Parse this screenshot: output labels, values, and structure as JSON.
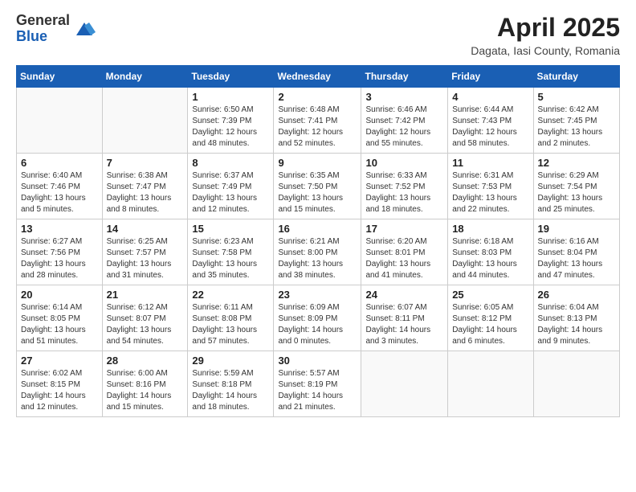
{
  "logo": {
    "general": "General",
    "blue": "Blue"
  },
  "title": "April 2025",
  "subtitle": "Dagata, Iasi County, Romania",
  "days_header": [
    "Sunday",
    "Monday",
    "Tuesday",
    "Wednesday",
    "Thursday",
    "Friday",
    "Saturday"
  ],
  "weeks": [
    [
      {
        "day": "",
        "detail": ""
      },
      {
        "day": "",
        "detail": ""
      },
      {
        "day": "1",
        "detail": "Sunrise: 6:50 AM\nSunset: 7:39 PM\nDaylight: 12 hours and 48 minutes."
      },
      {
        "day": "2",
        "detail": "Sunrise: 6:48 AM\nSunset: 7:41 PM\nDaylight: 12 hours and 52 minutes."
      },
      {
        "day": "3",
        "detail": "Sunrise: 6:46 AM\nSunset: 7:42 PM\nDaylight: 12 hours and 55 minutes."
      },
      {
        "day": "4",
        "detail": "Sunrise: 6:44 AM\nSunset: 7:43 PM\nDaylight: 12 hours and 58 minutes."
      },
      {
        "day": "5",
        "detail": "Sunrise: 6:42 AM\nSunset: 7:45 PM\nDaylight: 13 hours and 2 minutes."
      }
    ],
    [
      {
        "day": "6",
        "detail": "Sunrise: 6:40 AM\nSunset: 7:46 PM\nDaylight: 13 hours and 5 minutes."
      },
      {
        "day": "7",
        "detail": "Sunrise: 6:38 AM\nSunset: 7:47 PM\nDaylight: 13 hours and 8 minutes."
      },
      {
        "day": "8",
        "detail": "Sunrise: 6:37 AM\nSunset: 7:49 PM\nDaylight: 13 hours and 12 minutes."
      },
      {
        "day": "9",
        "detail": "Sunrise: 6:35 AM\nSunset: 7:50 PM\nDaylight: 13 hours and 15 minutes."
      },
      {
        "day": "10",
        "detail": "Sunrise: 6:33 AM\nSunset: 7:52 PM\nDaylight: 13 hours and 18 minutes."
      },
      {
        "day": "11",
        "detail": "Sunrise: 6:31 AM\nSunset: 7:53 PM\nDaylight: 13 hours and 22 minutes."
      },
      {
        "day": "12",
        "detail": "Sunrise: 6:29 AM\nSunset: 7:54 PM\nDaylight: 13 hours and 25 minutes."
      }
    ],
    [
      {
        "day": "13",
        "detail": "Sunrise: 6:27 AM\nSunset: 7:56 PM\nDaylight: 13 hours and 28 minutes."
      },
      {
        "day": "14",
        "detail": "Sunrise: 6:25 AM\nSunset: 7:57 PM\nDaylight: 13 hours and 31 minutes."
      },
      {
        "day": "15",
        "detail": "Sunrise: 6:23 AM\nSunset: 7:58 PM\nDaylight: 13 hours and 35 minutes."
      },
      {
        "day": "16",
        "detail": "Sunrise: 6:21 AM\nSunset: 8:00 PM\nDaylight: 13 hours and 38 minutes."
      },
      {
        "day": "17",
        "detail": "Sunrise: 6:20 AM\nSunset: 8:01 PM\nDaylight: 13 hours and 41 minutes."
      },
      {
        "day": "18",
        "detail": "Sunrise: 6:18 AM\nSunset: 8:03 PM\nDaylight: 13 hours and 44 minutes."
      },
      {
        "day": "19",
        "detail": "Sunrise: 6:16 AM\nSunset: 8:04 PM\nDaylight: 13 hours and 47 minutes."
      }
    ],
    [
      {
        "day": "20",
        "detail": "Sunrise: 6:14 AM\nSunset: 8:05 PM\nDaylight: 13 hours and 51 minutes."
      },
      {
        "day": "21",
        "detail": "Sunrise: 6:12 AM\nSunset: 8:07 PM\nDaylight: 13 hours and 54 minutes."
      },
      {
        "day": "22",
        "detail": "Sunrise: 6:11 AM\nSunset: 8:08 PM\nDaylight: 13 hours and 57 minutes."
      },
      {
        "day": "23",
        "detail": "Sunrise: 6:09 AM\nSunset: 8:09 PM\nDaylight: 14 hours and 0 minutes."
      },
      {
        "day": "24",
        "detail": "Sunrise: 6:07 AM\nSunset: 8:11 PM\nDaylight: 14 hours and 3 minutes."
      },
      {
        "day": "25",
        "detail": "Sunrise: 6:05 AM\nSunset: 8:12 PM\nDaylight: 14 hours and 6 minutes."
      },
      {
        "day": "26",
        "detail": "Sunrise: 6:04 AM\nSunset: 8:13 PM\nDaylight: 14 hours and 9 minutes."
      }
    ],
    [
      {
        "day": "27",
        "detail": "Sunrise: 6:02 AM\nSunset: 8:15 PM\nDaylight: 14 hours and 12 minutes."
      },
      {
        "day": "28",
        "detail": "Sunrise: 6:00 AM\nSunset: 8:16 PM\nDaylight: 14 hours and 15 minutes."
      },
      {
        "day": "29",
        "detail": "Sunrise: 5:59 AM\nSunset: 8:18 PM\nDaylight: 14 hours and 18 minutes."
      },
      {
        "day": "30",
        "detail": "Sunrise: 5:57 AM\nSunset: 8:19 PM\nDaylight: 14 hours and 21 minutes."
      },
      {
        "day": "",
        "detail": ""
      },
      {
        "day": "",
        "detail": ""
      },
      {
        "day": "",
        "detail": ""
      }
    ]
  ]
}
